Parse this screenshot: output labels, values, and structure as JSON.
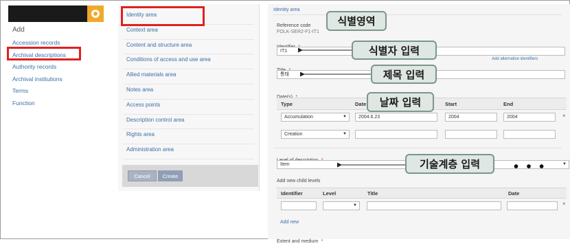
{
  "left_menu": {
    "title": "Add",
    "items": [
      "Accession records",
      "Archival descriptions",
      "Authority records",
      "Archival institutions",
      "Terms",
      "Function"
    ]
  },
  "mid_menu": {
    "items": [
      "Identity area",
      "Context area",
      "Content and structure area",
      "Conditions of access and use area",
      "Allied materials area",
      "Notes area",
      "Access points",
      "Description control area",
      "Rights area",
      "Administration area"
    ],
    "cancel_label": "Cancel",
    "create_label": "Create"
  },
  "form": {
    "section_title": "Identity area",
    "reference_code_label": "Reference code",
    "reference_code_value": "FOLK-SER2-F1-IT1",
    "identifier_label": "Identifier",
    "identifier_value": "IT1",
    "add_alt_identifiers": "Add alternative identifiers",
    "title_label": "Title",
    "title_value": "통태",
    "dates_label": "Date(s)",
    "dates_columns": [
      "Type",
      "Date",
      "Start",
      "End"
    ],
    "dates_rows": [
      {
        "type": "Accumulation",
        "date": "2004.6.23",
        "start": "2004",
        "end": "2004"
      },
      {
        "type": "Creation",
        "date": "",
        "start": "",
        "end": ""
      }
    ],
    "level_label": "Level of description",
    "level_value": "Item",
    "child_levels_label": "Add new child levels",
    "child_columns": [
      "Identifier",
      "Level",
      "Title",
      "Date"
    ],
    "add_new": "Add new",
    "extent_label": "Extent and medium",
    "required_marker": "*",
    "close_symbol": "×"
  },
  "annotations": {
    "identity": "식별영역",
    "identifier": "식별자 입력",
    "title": "제목 입력",
    "date": "날짜 입력",
    "level": "기술계층 입력",
    "dots": "• • •"
  },
  "colors": {
    "highlight_red": "#e02020",
    "callout_bg": "#dfe7e2",
    "callout_border": "#7a9590",
    "link_blue": "#3a6ea5",
    "logo_orange": "#f0a92a"
  }
}
